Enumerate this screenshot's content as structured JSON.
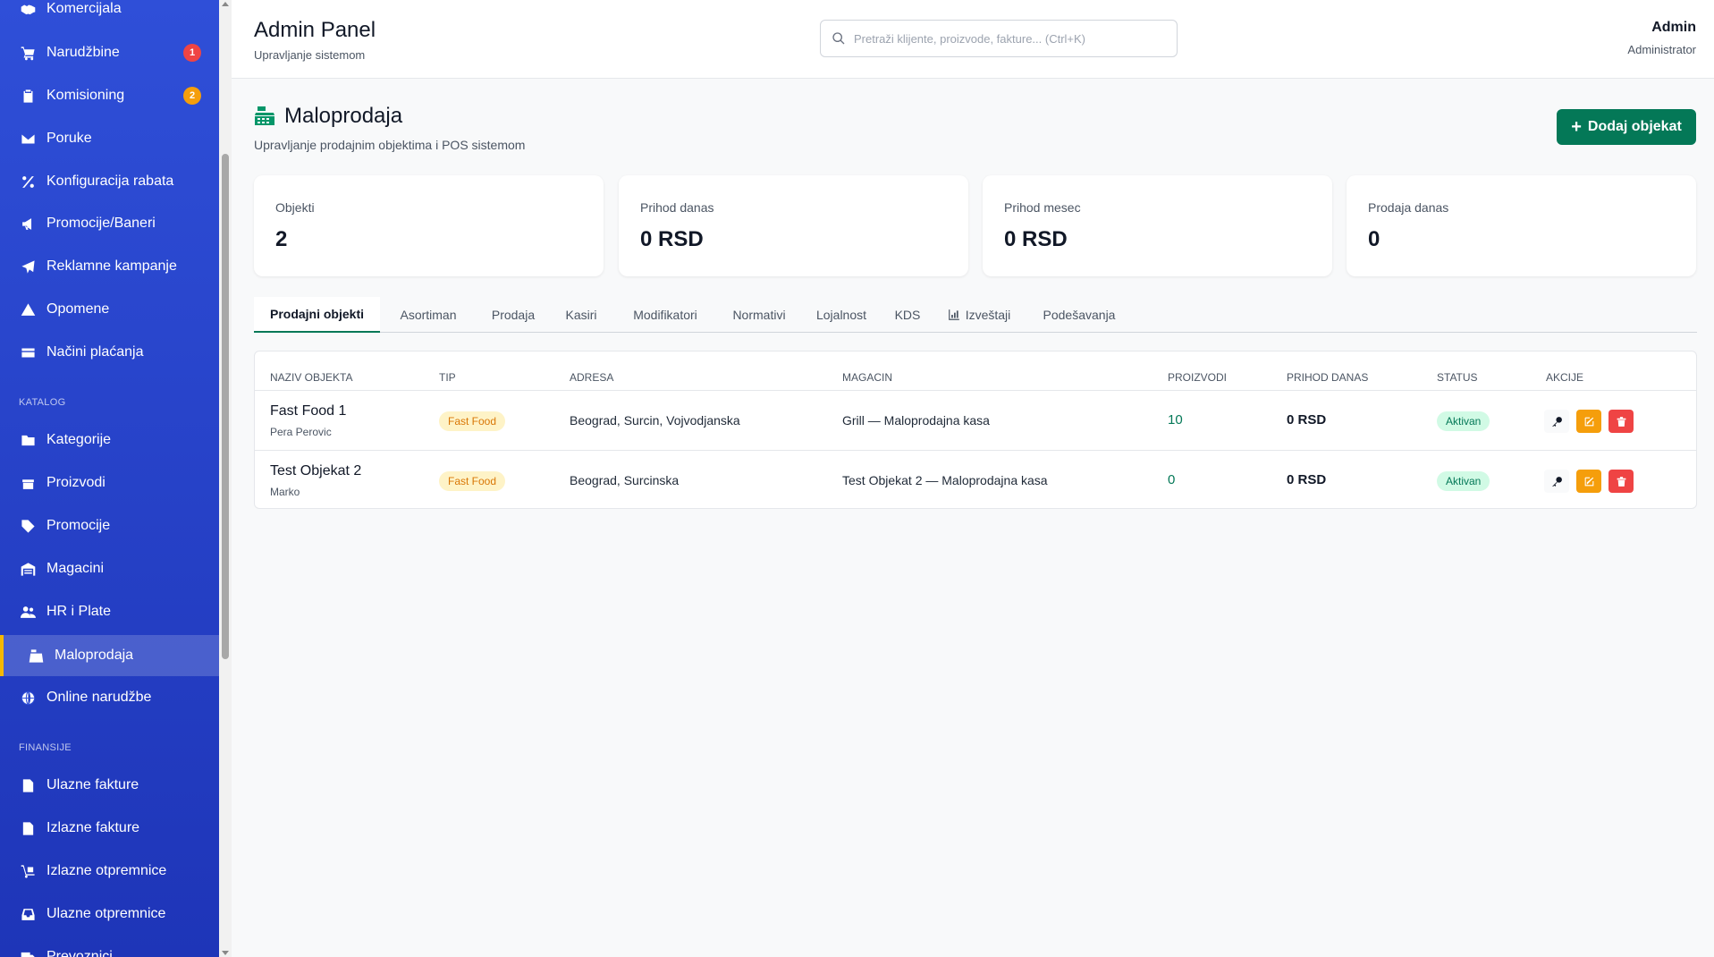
{
  "sidebar": {
    "items_top": [
      {
        "label": "Komercijala",
        "icon": "handshake-icon"
      },
      {
        "label": "Narudžbine",
        "icon": "cart-icon",
        "badge": "1",
        "badge_color": "#ef4444"
      },
      {
        "label": "Komisioning",
        "icon": "clipboard-icon",
        "badge": "2",
        "badge_color": "#f59e0b"
      },
      {
        "label": "Poruke",
        "icon": "envelope-icon"
      },
      {
        "label": "Konfiguracija rabata",
        "icon": "percent-icon"
      },
      {
        "label": "Promocije/Baneri",
        "icon": "megaphone-icon"
      },
      {
        "label": "Reklamne kampanje",
        "icon": "paper-plane-icon"
      },
      {
        "label": "Opomene",
        "icon": "warning-icon"
      },
      {
        "label": "Načini plaćanja",
        "icon": "credit-card-icon"
      }
    ],
    "section_catalog": "KATALOG",
    "items_catalog": [
      {
        "label": "Kategorije",
        "icon": "folder-icon"
      },
      {
        "label": "Proizvodi",
        "icon": "box-icon"
      },
      {
        "label": "Promocije",
        "icon": "tag-icon"
      },
      {
        "label": "Magacini",
        "icon": "warehouse-icon"
      },
      {
        "label": "HR i Plate",
        "icon": "users-icon"
      },
      {
        "label": "Maloprodaja",
        "icon": "cash-register-icon",
        "active": true
      },
      {
        "label": "Online narudžbe",
        "icon": "globe-icon"
      }
    ],
    "section_finance": "FINANSIJE",
    "items_finance": [
      {
        "label": "Ulazne fakture",
        "icon": "file-invoice-icon"
      },
      {
        "label": "Izlazne fakture",
        "icon": "file-invoice-out-icon"
      },
      {
        "label": "Izlazne otpremnice",
        "icon": "dolly-icon"
      },
      {
        "label": "Ulazne otpremnice",
        "icon": "inbox-icon"
      },
      {
        "label": "Prevoznici",
        "icon": "truck-icon"
      }
    ]
  },
  "header": {
    "title": "Admin Panel",
    "subtitle": "Upravljanje sistemom",
    "search_placeholder": "Pretraži klijente, proizvode, fakture... (Ctrl+K)",
    "user_name": "Admin",
    "user_role": "Administrator"
  },
  "page": {
    "title": "Maloprodaja",
    "subtitle": "Upravljanje prodajnim objektima i POS sistemom",
    "add_button": "Dodaj objekat"
  },
  "stats": [
    {
      "label": "Objekti",
      "value": "2"
    },
    {
      "label": "Prihod danas",
      "value": "0 RSD"
    },
    {
      "label": "Prihod mesec",
      "value": "0 RSD"
    },
    {
      "label": "Prodaja danas",
      "value": "0"
    }
  ],
  "tabs": [
    {
      "label": "Prodajni objekti",
      "active": true
    },
    {
      "label": "Asortiman"
    },
    {
      "label": "Prodaja"
    },
    {
      "label": "Kasiri"
    },
    {
      "label": "Modifikatori"
    },
    {
      "label": "Normativi"
    },
    {
      "label": "Lojalnost"
    },
    {
      "label": "KDS"
    },
    {
      "label": "Izveštaji",
      "icon": "chart-icon"
    },
    {
      "label": "Podešavanja"
    }
  ],
  "table": {
    "headers": [
      "NAZIV OBJEKTA",
      "TIP",
      "ADRESA",
      "MAGACIN",
      "PROIZVODI",
      "PRIHOD DANAS",
      "STATUS",
      "AKCIJE"
    ],
    "rows": [
      {
        "name": "Fast Food 1",
        "manager": "Pera Perovic",
        "type": "Fast Food",
        "address": "Beograd, Surcin, Vojvodjanska",
        "warehouse": "Grill — Maloprodajna kasa",
        "products": "10",
        "income": "0 RSD",
        "status": "Aktivan"
      },
      {
        "name": "Test Objekat 2",
        "manager": "Marko",
        "type": "Fast Food",
        "address": "Beograd, Surcinska",
        "warehouse": "Test Objekat 2 — Maloprodajna kasa",
        "products": "0",
        "income": "0 RSD",
        "status": "Aktivan"
      }
    ]
  }
}
